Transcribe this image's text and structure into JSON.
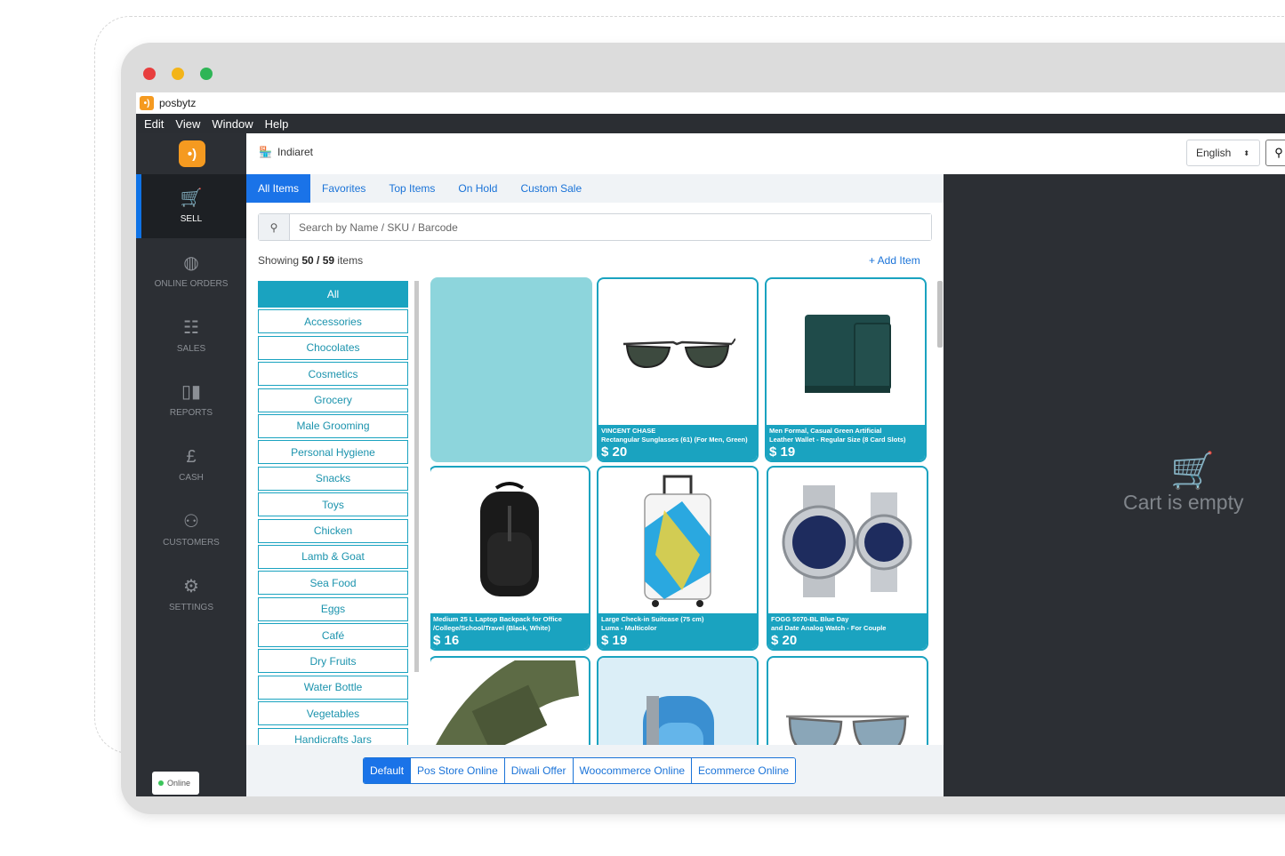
{
  "window": {
    "app_name": "posbytz"
  },
  "menubar": [
    "Edit",
    "View",
    "Window",
    "Help"
  ],
  "sidebar": {
    "items": [
      {
        "label": "SELL",
        "icon": "cart-icon"
      },
      {
        "label": "ONLINE ORDERS",
        "icon": "globe-icon"
      },
      {
        "label": "SALES",
        "icon": "checklist-icon"
      },
      {
        "label": "REPORTS",
        "icon": "bar-chart-icon"
      },
      {
        "label": "CASH",
        "icon": "cash-icon"
      },
      {
        "label": "CUSTOMERS",
        "icon": "users-icon"
      },
      {
        "label": "SETTINGS",
        "icon": "gear-icon"
      }
    ],
    "status": "Online"
  },
  "header": {
    "store_name": "Indiaret",
    "language": "English"
  },
  "tabs": [
    "All Items",
    "Favorites",
    "Top Items",
    "On Hold",
    "Custom Sale"
  ],
  "search": {
    "placeholder": "Search by Name / SKU / Barcode"
  },
  "summary": {
    "showing_prefix": "Showing",
    "showing_count": "50 / 59",
    "showing_suffix": "items",
    "add_item": "+ Add Item"
  },
  "categories": [
    "All",
    "Accessories",
    "Chocolates",
    "Cosmetics",
    "Grocery",
    "Male Grooming",
    "Personal Hygiene",
    "Snacks",
    "Toys",
    "Chicken",
    "Lamb & Goat",
    "Sea Food",
    "Eggs",
    "Café",
    "Dry Fruits",
    "Water Bottle",
    "Vegetables",
    "Handicrafts Jars"
  ],
  "products": [
    {
      "name": "",
      "price": "",
      "image": "empty"
    },
    {
      "name": "VINCENT CHASE\nRectangular Sunglasses (61)  (For Men, Green)",
      "price": "$ 20",
      "image": "sunglasses"
    },
    {
      "name": "Men Formal, Casual Green Artificial\nLeather Wallet - Regular Size  (8 Card Slots)",
      "price": "$ 19",
      "image": "wallet"
    },
    {
      "name": "Medium 25 L Laptop Backpack for Office\n/College/School/Travel  (Black, White)",
      "price": "$ 16",
      "image": "backpack"
    },
    {
      "name": "Large Check-in Suitcase (75 cm)\nLuma - Multicolor",
      "price": "$ 19",
      "image": "suitcase"
    },
    {
      "name": "FOGG 5070-BL Blue Day\nand Date Analog Watch - For Couple",
      "price": "$ 20",
      "image": "watch"
    },
    {
      "name": "",
      "price": "",
      "image": "belt"
    },
    {
      "name": "",
      "price": "",
      "image": "blue-backpack"
    },
    {
      "name": "",
      "price": "",
      "image": "aviators"
    }
  ],
  "price_lists": [
    "Default",
    "Pos Store Online",
    "Diwali Offer",
    "Woocommerce Online",
    "Ecommerce Online"
  ],
  "cart": {
    "empty_text": "Cart is empty"
  }
}
